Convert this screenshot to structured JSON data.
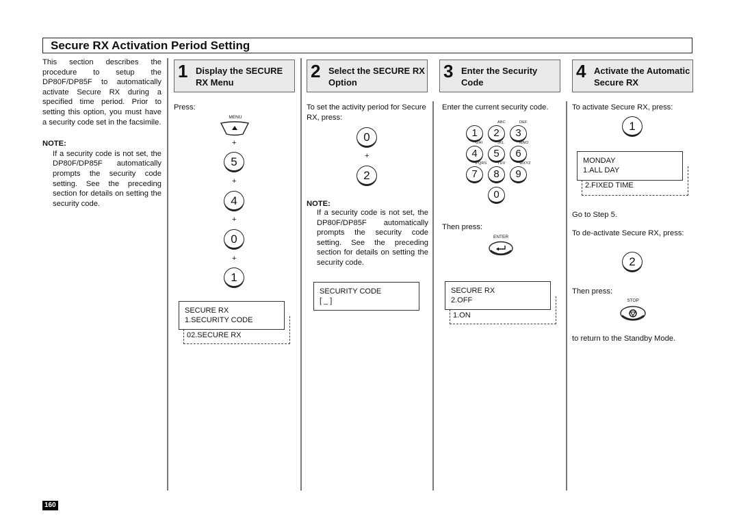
{
  "page": {
    "title": "Secure RX Activation Period Setting",
    "page_number": "160"
  },
  "intro": {
    "text": "This section describes the procedure to setup the DP80F/DP85F to automatically activate Secure RX during a specified time period. Prior to setting this option, you must have a security code set in the facsimile.",
    "note_heading": "NOTE:",
    "note_text": "If a security code is not set, the DP80F/DP85F automatically prompts the security code setting. See the preceding section for details on setting the security code."
  },
  "steps": [
    {
      "number": "1",
      "title": "Display the SECURE RX Menu",
      "press_label": "Press:",
      "menu_key_label": "MENU",
      "keys": [
        "5",
        "4",
        "0",
        "1"
      ],
      "plus": "+",
      "lcd": {
        "line1": "SECURE RX",
        "line2": "1.SECURITY CODE",
        "next": "02.SECURE RX"
      }
    },
    {
      "number": "2",
      "title": "Select the SECURE RX Option",
      "instruction": "To set the activity period for Secure RX, press:",
      "keys": [
        "0",
        "2"
      ],
      "plus": "+",
      "note_heading": "NOTE:",
      "note_text": "If a security code is not set, the DP80F/DP85F automatically prompts the security code setting. See the preceding section for details on setting the security code.",
      "lcd": {
        "line1": "SECURITY CODE",
        "line2": "[ _ ]"
      }
    },
    {
      "number": "3",
      "title": "Enter the Security Code",
      "instruction": "Enter the current security code.",
      "keypad": [
        {
          "key": "1",
          "letters": ""
        },
        {
          "key": "2",
          "letters": "ABC"
        },
        {
          "key": "3",
          "letters": "DEF"
        },
        {
          "key": "4",
          "letters": "GHI"
        },
        {
          "key": "5",
          "letters": "JKL"
        },
        {
          "key": "6",
          "letters": "MNO"
        },
        {
          "key": "7",
          "letters": "PQRS"
        },
        {
          "key": "8",
          "letters": "TUV"
        },
        {
          "key": "9",
          "letters": "WXYZ"
        },
        {
          "key": "0",
          "letters": ""
        }
      ],
      "then_press": "Then press:",
      "enter_key_label": "ENTER",
      "lcd": {
        "line1": "SECURE RX",
        "line2": "2.OFF",
        "next": "1.ON"
      }
    },
    {
      "number": "4",
      "title": "Activate the Automatic Secure RX",
      "activate_instruction": "To activate Secure RX, press:",
      "activate_key": "1",
      "lcd": {
        "line1": "MONDAY",
        "line2": "1.ALL DAY",
        "next": "2.FIXED TIME"
      },
      "goto": "Go to Step 5.",
      "deactivate_instruction": "To de-activate Secure RX, press:",
      "deactivate_key": "2",
      "then_press": "Then press:",
      "stop_key_label": "STOP",
      "return_text": "to return to the Standby Mode."
    }
  ]
}
